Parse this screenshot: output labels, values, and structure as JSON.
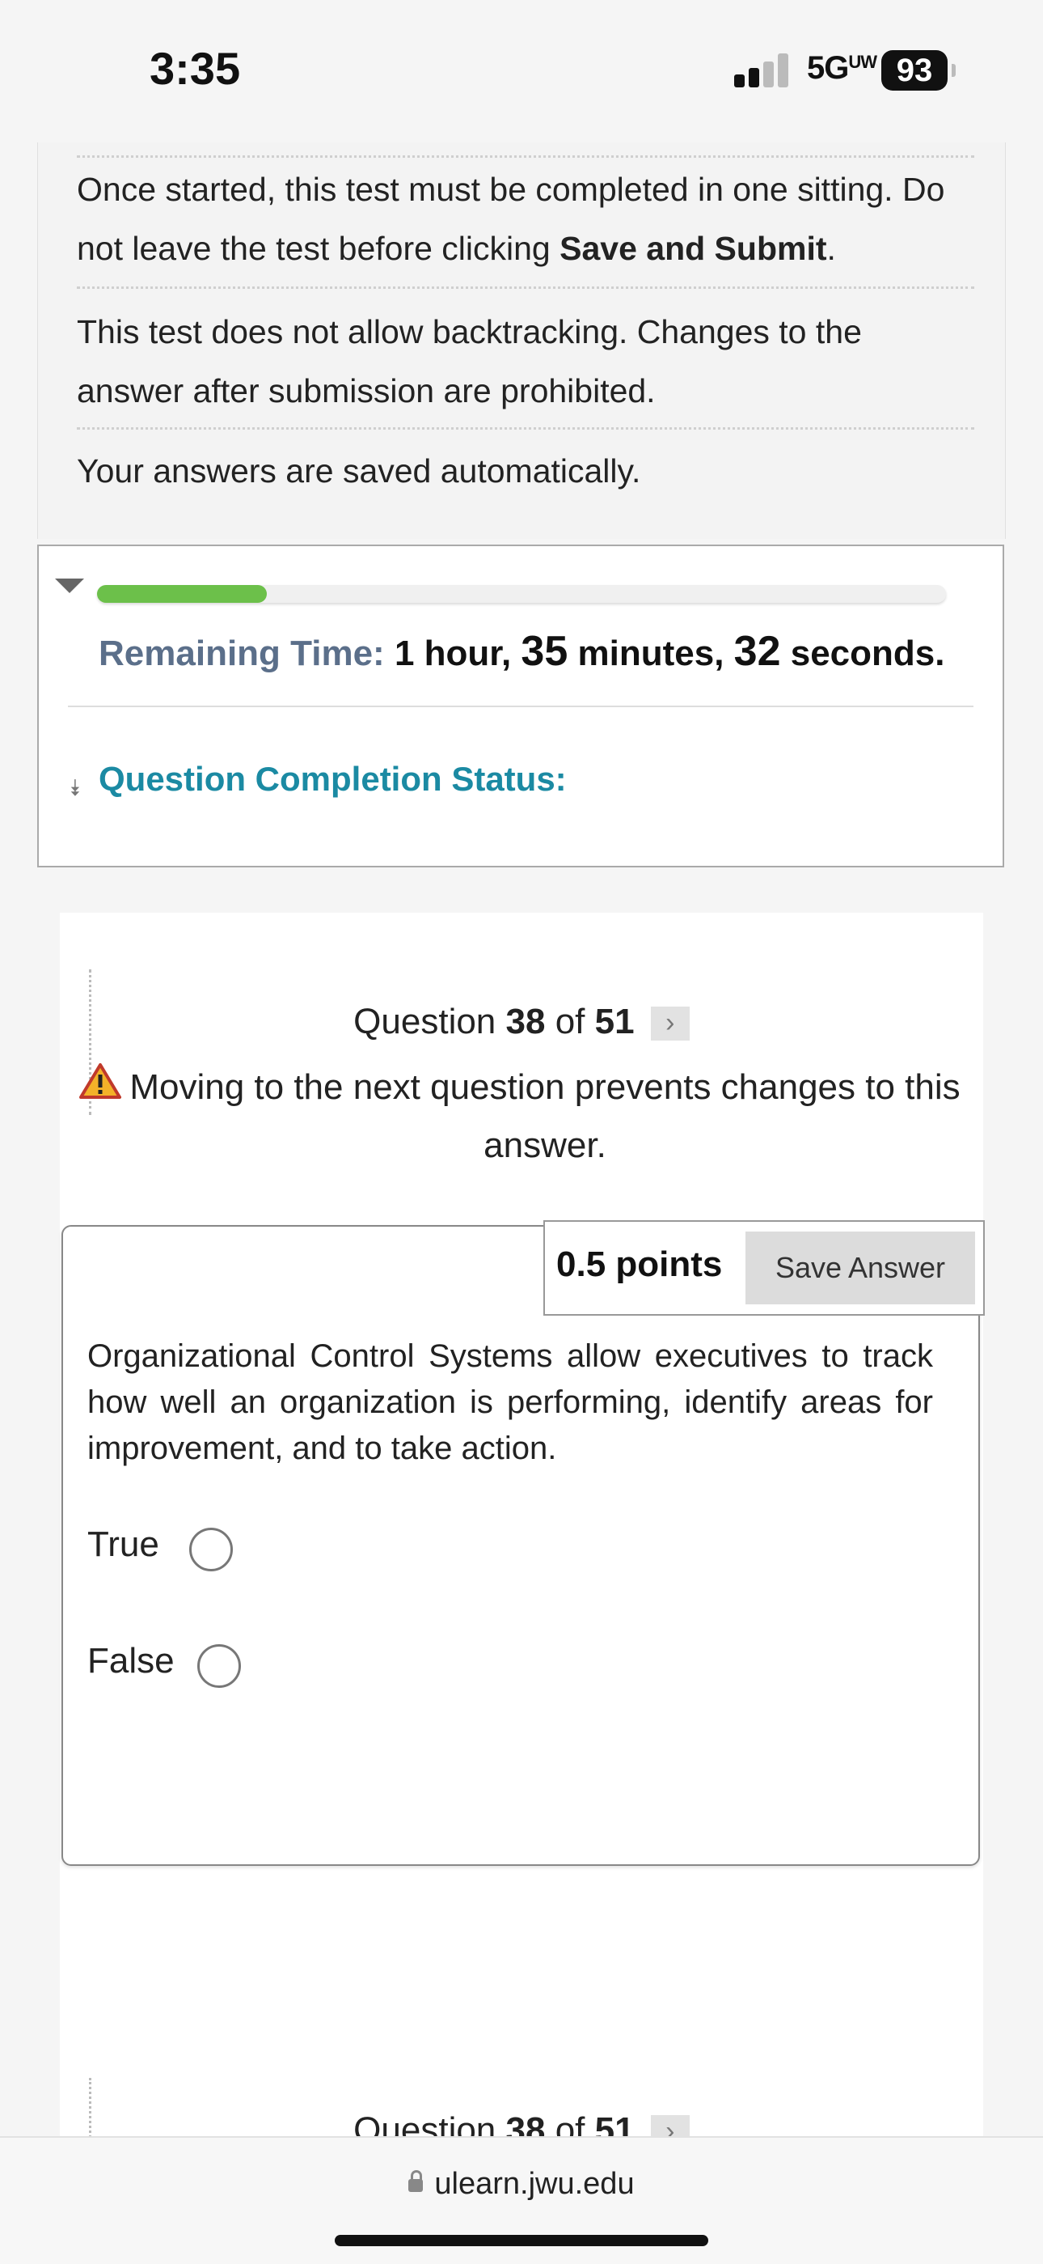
{
  "status_bar": {
    "time": "3:35",
    "network": "5G",
    "network_suffix": "UW",
    "battery": "93"
  },
  "instructions": {
    "item1_text": "Once started, this test must be completed in one sitting. Do not leave the test before clicking ",
    "item1_bold": "Save and Submit",
    "item1_end": ".",
    "item2": "This test does not allow backtracking. Changes to the answer after submission are prohibited.",
    "item3": "Your answers are saved automatically."
  },
  "timer": {
    "progress_fraction": 0.2,
    "label": "Remaining Time:",
    "hours": "1 hour,",
    "minutes_num": "35",
    "minutes_label": "minutes,",
    "seconds_num": "32",
    "seconds_label": "seconds."
  },
  "completion_status": {
    "label": "Question Completion Status:"
  },
  "question": {
    "header_prefix": "Question",
    "number": "38",
    "of_label": "of",
    "total": "51",
    "next_icon": "chevron-right-icon",
    "warning": "Moving to the next question prevents changes to this answer.",
    "points": "0.5 points",
    "save_label": "Save Answer",
    "text": "Organizational Control Systems allow executives to track how well an organization is performing, identify areas for improvement, and to take action.",
    "options": [
      {
        "label": "True"
      },
      {
        "label": "False"
      }
    ]
  },
  "url_bar": {
    "url": "ulearn.jwu.edu"
  },
  "colors": {
    "timer_label": "#5b6f8a",
    "completion": "#1b8aa3",
    "progress": "#6cc04a"
  }
}
